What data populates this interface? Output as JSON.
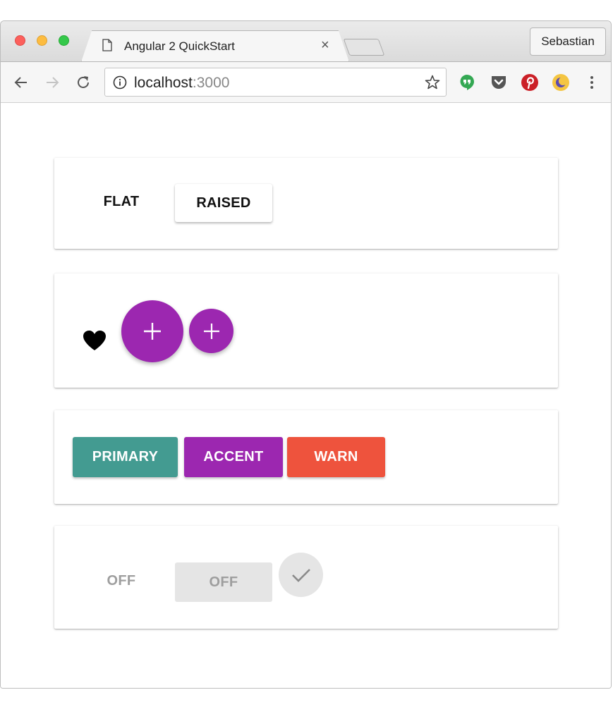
{
  "window": {
    "tab_title": "Angular 2 QuickStart",
    "profile_name": "Sebastian"
  },
  "toolbar": {
    "url_host": "localhost",
    "url_port": ":3000",
    "extensions": [
      "hangouts-icon",
      "pocket-icon",
      "pinterest-icon",
      "night-mode-icon"
    ]
  },
  "cards": {
    "basic": {
      "flat_label": "FLAT",
      "raised_label": "RAISED"
    },
    "icons": {
      "fab_symbol": "+",
      "mini_fab_symbol": "+"
    },
    "colors": {
      "primary_label": "PRIMARY",
      "accent_label": "ACCENT",
      "warn_label": "WARN"
    },
    "disabled": {
      "flat_label": "OFF",
      "raised_label": "OFF"
    }
  },
  "colors": {
    "primary": "#439b91",
    "accent": "#9c27b0",
    "warn": "#ee533d",
    "disabled_bg": "#e5e5e5",
    "disabled_text": "#9e9e9e"
  }
}
